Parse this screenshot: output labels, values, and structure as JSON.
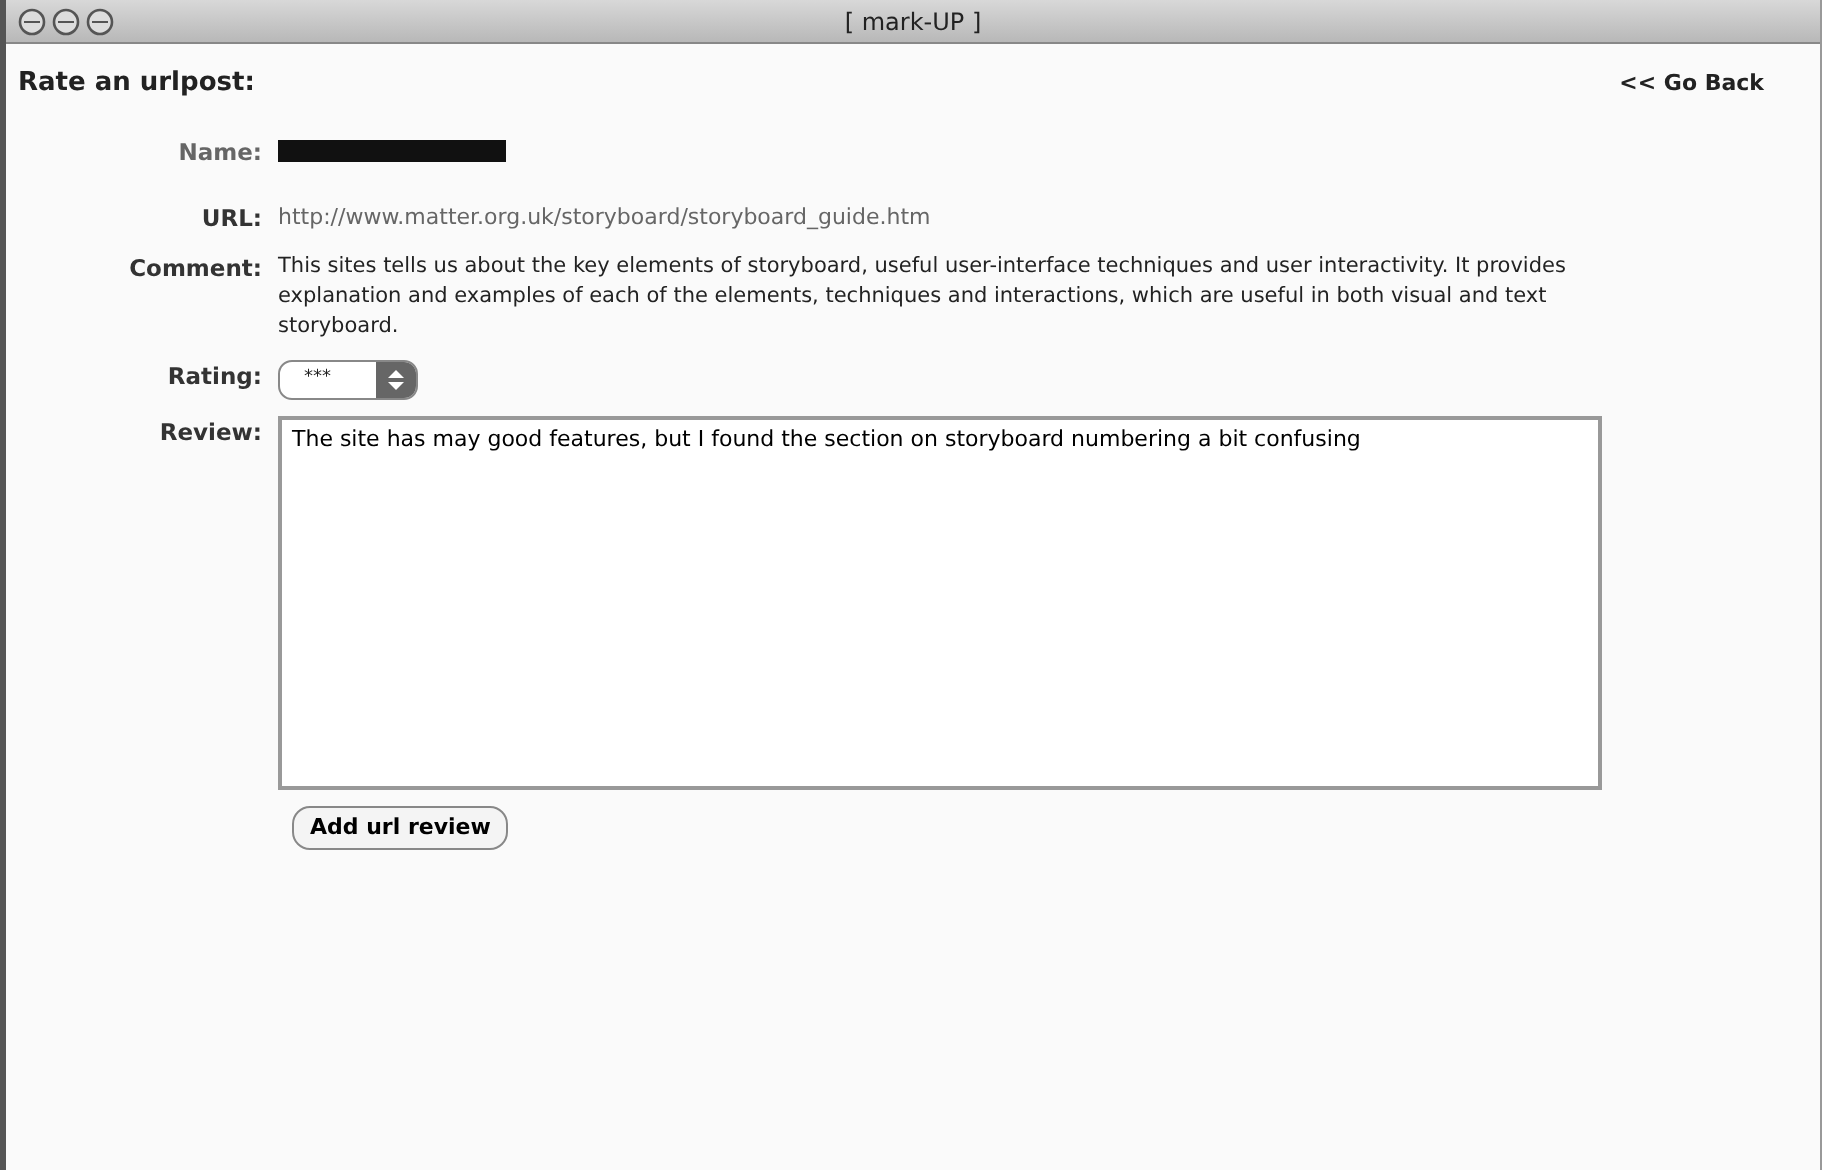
{
  "window": {
    "title": "[ mark-UP ]"
  },
  "heading": "Rate an urlpost:",
  "go_back": "<< Go Back",
  "fields": [
    {
      "label": "Name:",
      "kind": "redacted"
    },
    {
      "label": "URL:",
      "kind": "link",
      "value": "http://www.matter.org.uk/storyboard/storyboard_guide.htm"
    },
    {
      "label": "Comment:",
      "kind": "text",
      "value": "This sites tells us about the key elements of storyboard, useful user-interface techniques and user interactivity. It provides explanation and examples of each of the elements, techniques and interactions, which are useful in both visual and text storyboard."
    },
    {
      "label": "Rating:",
      "kind": "popup",
      "value": "***"
    },
    {
      "label": "Review:",
      "kind": "textarea",
      "value": "The site has may good features, but I found the section on storyboard numbering a bit confusing"
    }
  ],
  "submit": "Add url review"
}
